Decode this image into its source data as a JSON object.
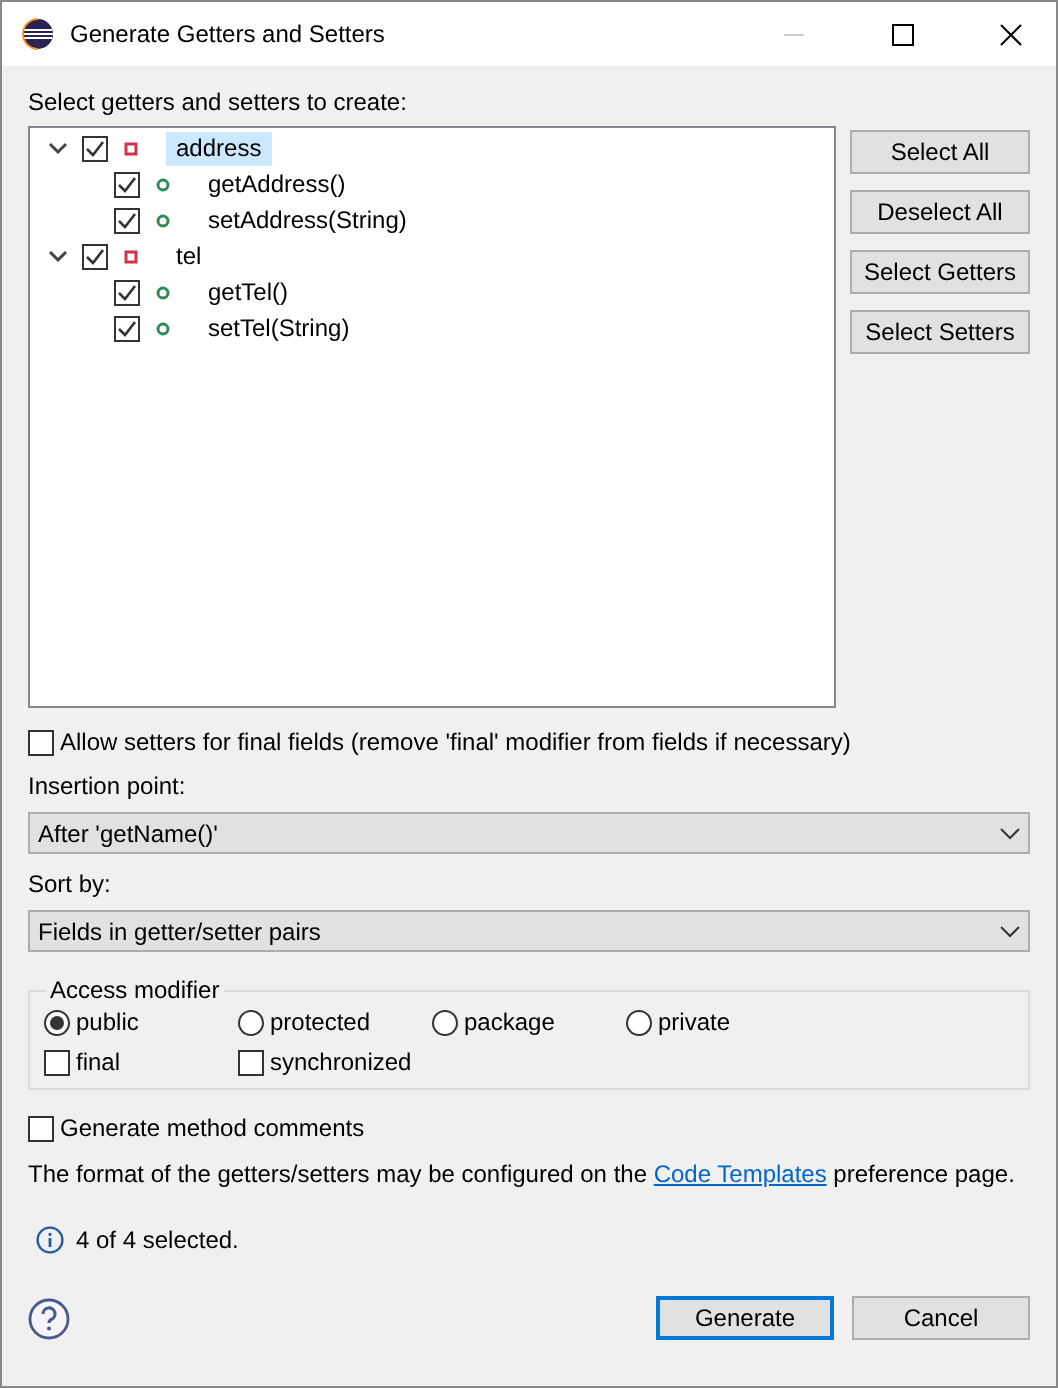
{
  "window": {
    "title": "Generate Getters and Setters"
  },
  "tree_label": "Select getters and setters to create:",
  "tree": [
    {
      "label": "address",
      "checked": true,
      "expanded": true,
      "selected": true,
      "children": [
        {
          "label": "getAddress()",
          "checked": true,
          "selected": false
        },
        {
          "label": "setAddress(String)",
          "checked": true,
          "selected": false
        }
      ]
    },
    {
      "label": "tel",
      "checked": true,
      "expanded": true,
      "selected": false,
      "children": [
        {
          "label": "getTel()",
          "checked": true,
          "selected": false
        },
        {
          "label": "setTel(String)",
          "checked": true,
          "selected": false
        }
      ]
    }
  ],
  "side_buttons": [
    "Select All",
    "Deselect All",
    "Select Getters",
    "Select Setters"
  ],
  "allow_setters": {
    "label": "Allow setters for final fields (remove 'final' modifier from fields if necessary)",
    "checked": false
  },
  "insertion_point": {
    "label": "Insertion point:",
    "value": "After 'getName()'"
  },
  "sort_by": {
    "label": "Sort by:",
    "value": "Fields in getter/setter pairs"
  },
  "access_modifier": {
    "title": "Access modifier",
    "options": [
      {
        "label": "public",
        "selected": true
      },
      {
        "label": "protected",
        "selected": false
      },
      {
        "label": "package",
        "selected": false
      },
      {
        "label": "private",
        "selected": false
      }
    ],
    "flags": [
      {
        "label": "final",
        "checked": false
      },
      {
        "label": "synchronized",
        "checked": false
      }
    ]
  },
  "method_comments": {
    "label": "Generate method comments",
    "checked": false
  },
  "format_note": {
    "before": "The format of the getters/setters may be configured on the ",
    "link": "Code Templates",
    "after": " preference page."
  },
  "status": "4 of 4 selected.",
  "buttons": [
    {
      "label": "Generate",
      "default": true
    },
    {
      "label": "Cancel",
      "default": false
    }
  ]
}
